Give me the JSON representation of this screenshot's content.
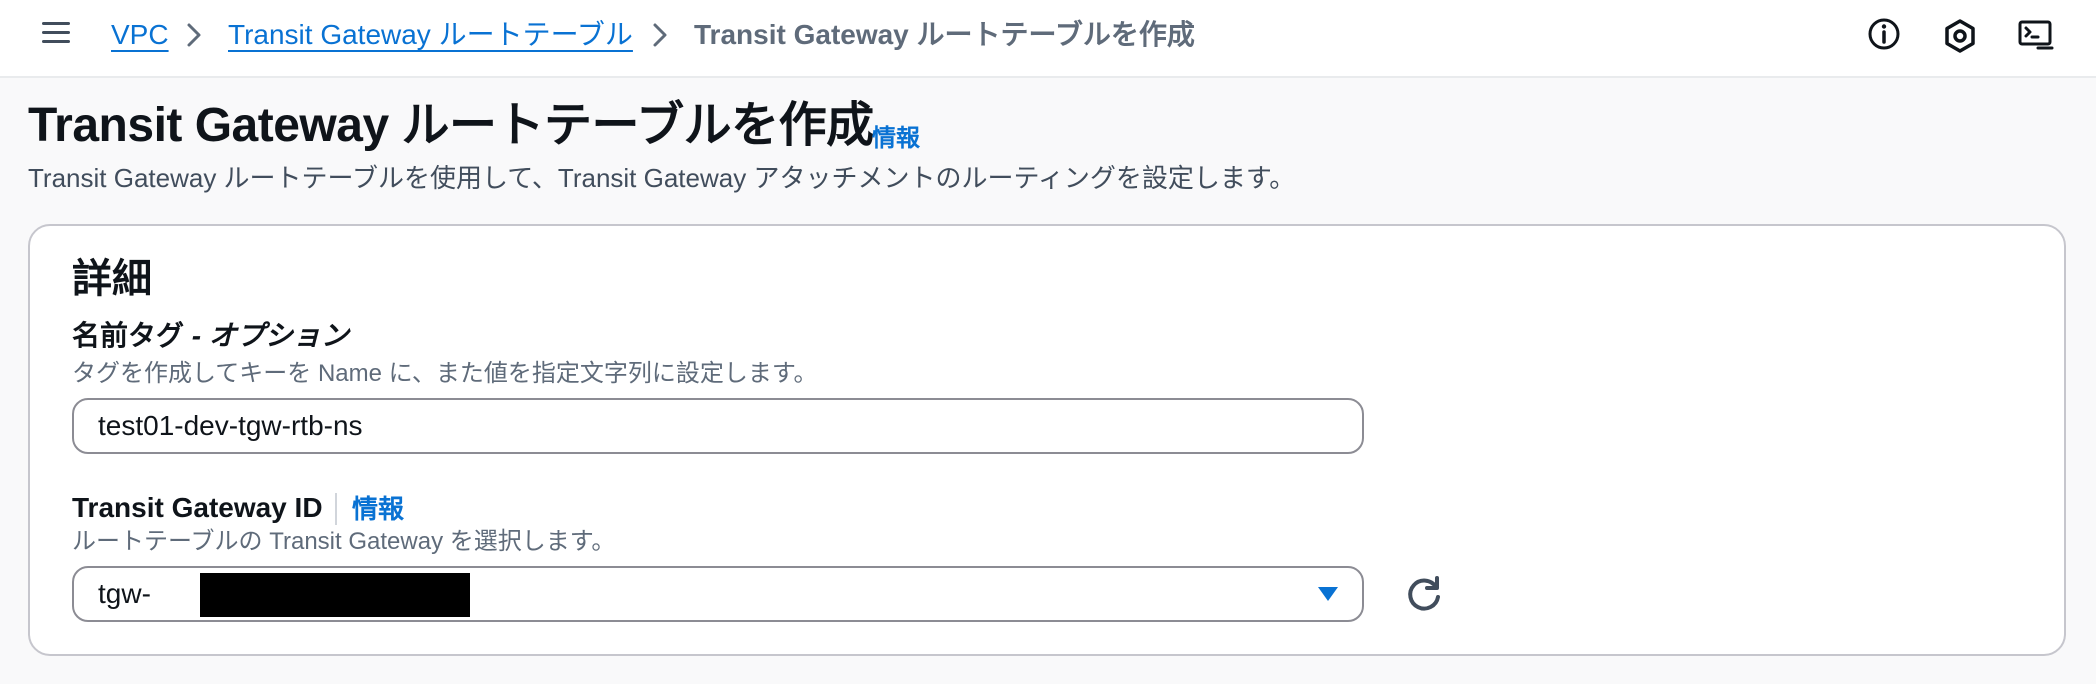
{
  "breadcrumb": {
    "items": [
      "VPC",
      "Transit Gateway ルートテーブル"
    ],
    "current": "Transit Gateway ルートテーブルを作成"
  },
  "header": {
    "title": "Transit Gateway ルートテーブルを作成",
    "info_link": "情報",
    "description": "Transit Gateway ルートテーブルを使用して、Transit Gateway アタッチメントのルーティングを設定します。"
  },
  "details": {
    "title": "詳細",
    "name_tag": {
      "label": "名前タグ",
      "label_optional": " - オプション",
      "description": "タグを作成してキーを Name に、また値を指定文字列に設定します。",
      "value": "test01-dev-tgw-rtb-ns"
    },
    "tgw_id": {
      "label": "Transit Gateway ID",
      "info_link": "情報",
      "description": "ルートテーブルの Transit Gateway を選択します。",
      "value_prefix": "tgw-"
    }
  },
  "colors": {
    "link": "#0972d3",
    "text": "#0f141a",
    "secondary_text": "#5f6b7a",
    "border": "#8c8c94"
  },
  "icons": [
    "menu-icon",
    "chevron-right-icon",
    "info-circle-icon",
    "settings-hex-icon",
    "cloudshell-icon",
    "caret-down-icon",
    "refresh-icon"
  ]
}
